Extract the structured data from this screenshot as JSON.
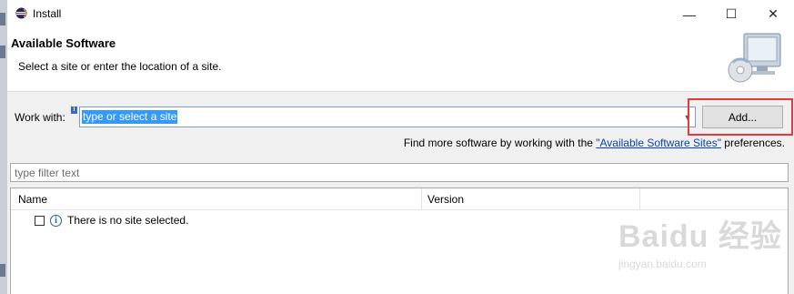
{
  "window": {
    "title": "Install",
    "minimize_glyph": "—",
    "maximize_glyph": "☐",
    "close_glyph": "✕"
  },
  "header": {
    "title": "Available Software",
    "description": "Select a site or enter the location of a site."
  },
  "work_with": {
    "label": "Work with:",
    "value": "type or select a site",
    "add_label": "Add..."
  },
  "find_more": {
    "prefix": "Find more software by working with the ",
    "link": "\"Available Software Sites\"",
    "suffix": " preferences."
  },
  "filter": {
    "placeholder": "type filter text"
  },
  "table": {
    "columns": [
      "Name",
      "Version"
    ],
    "rows": [
      {
        "text": "There is no site selected.",
        "checked": false
      }
    ]
  },
  "watermark": {
    "main": "Baidu 经验",
    "sub": "jingyan.baidu.com"
  },
  "colors": {
    "selection": "#3399ff",
    "highlight_box": "#e63a3a",
    "link": "#0645ad"
  }
}
